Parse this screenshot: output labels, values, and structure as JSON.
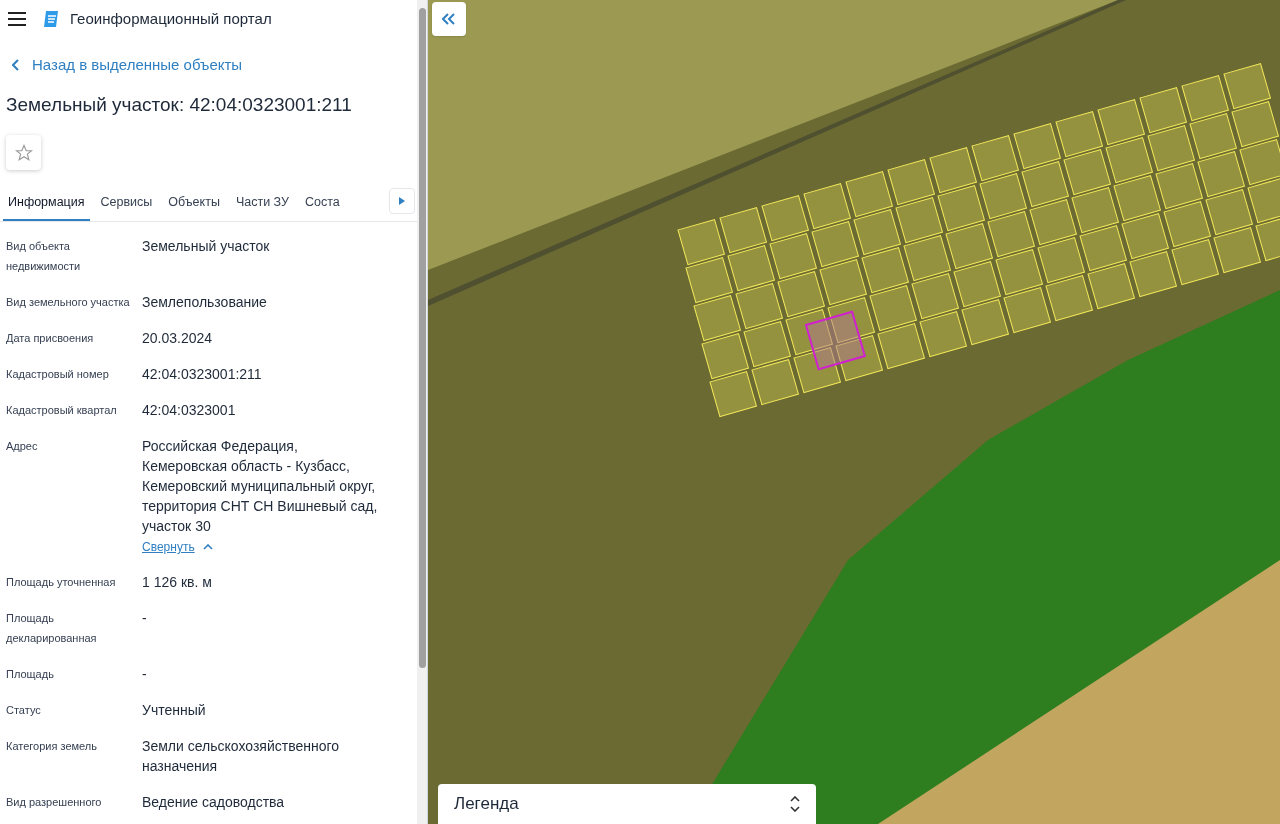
{
  "header": {
    "title": "Геоинформационный портал"
  },
  "back_link": "Назад в выделенные объекты",
  "object_title": "Земельный участок: 42:04:0323001:211",
  "favorite": {
    "on": false
  },
  "tabs": [
    {
      "label": "Информация",
      "selected": true
    },
    {
      "label": "Сервисы",
      "selected": false
    },
    {
      "label": "Объекты",
      "selected": false
    },
    {
      "label": "Части ЗУ",
      "selected": false
    },
    {
      "label": "Соста",
      "selected": false
    }
  ],
  "fields": [
    {
      "label": "Вид объекта недвижимости",
      "value": [
        "Земельный участок"
      ]
    },
    {
      "label": "Вид земельного участка",
      "value": [
        "Землепользование"
      ]
    },
    {
      "label": "Дата присвоения",
      "value": [
        "20.03.2024"
      ]
    },
    {
      "label": "Кадастровый номер",
      "value": [
        "42:04:0323001:211"
      ]
    },
    {
      "label": "Кадастровый квартал",
      "value": [
        "42:04:0323001"
      ]
    },
    {
      "label": "Адрес",
      "value": [
        "Российская Федерация,",
        "Кемеровская область - Кузбасс,",
        "Кемеровский муниципальный округ,",
        "территория СНТ СН Вишневый сад,",
        "участок 30"
      ],
      "toggle": {
        "label": "Свернуть",
        "expanded": true
      }
    },
    {
      "label": "Площадь уточненная",
      "value": [
        "1 126 кв. м"
      ]
    },
    {
      "label": "Площадь декларированная",
      "value": [
        "-"
      ]
    },
    {
      "label": "Площадь",
      "value": [
        "-"
      ]
    },
    {
      "label": "Статус",
      "value": [
        "Учтенный"
      ]
    },
    {
      "label": "Категория земель",
      "value": [
        "Земли сельскохозяйственного",
        "назначения"
      ]
    },
    {
      "label": "Вид разрешенного",
      "value": [
        "Ведение садоводства"
      ]
    }
  ],
  "legend": {
    "label": "Легенда"
  }
}
